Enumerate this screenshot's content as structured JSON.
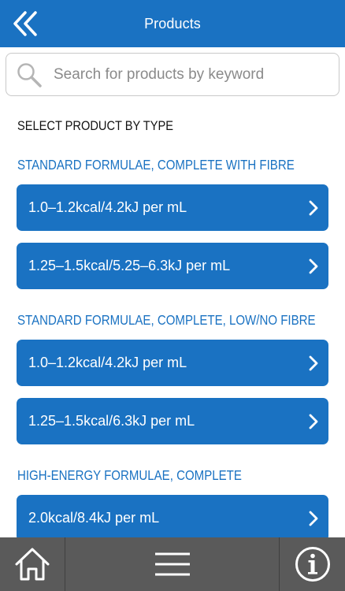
{
  "header": {
    "title": "Products"
  },
  "search": {
    "placeholder": "Search for products by keyword"
  },
  "section_title": "SELECT PRODUCT BY TYPE",
  "groups": [
    {
      "title": "STANDARD FORMULAE, COMPLETE WITH FIBRE",
      "items": [
        {
          "label": "1.0–1.2kcal/4.2kJ per mL"
        },
        {
          "label": "1.25–1.5kcal/5.25–6.3kJ per mL"
        }
      ]
    },
    {
      "title": "STANDARD FORMULAE, COMPLETE, LOW/NO FIBRE",
      "items": [
        {
          "label": "1.0–1.2kcal/4.2kJ per mL"
        },
        {
          "label": "1.25–1.5kcal/6.3kJ per mL"
        }
      ]
    },
    {
      "title": "HIGH-ENERGY FORMULAE, COMPLETE",
      "items": [
        {
          "label": "2.0kcal/8.4kJ per mL"
        }
      ]
    }
  ],
  "footer": {
    "icons": [
      "home-icon",
      "menu-icon",
      "info-icon"
    ]
  },
  "colors": {
    "primary": "#1a72c2",
    "footer": "#5a5a5a"
  }
}
